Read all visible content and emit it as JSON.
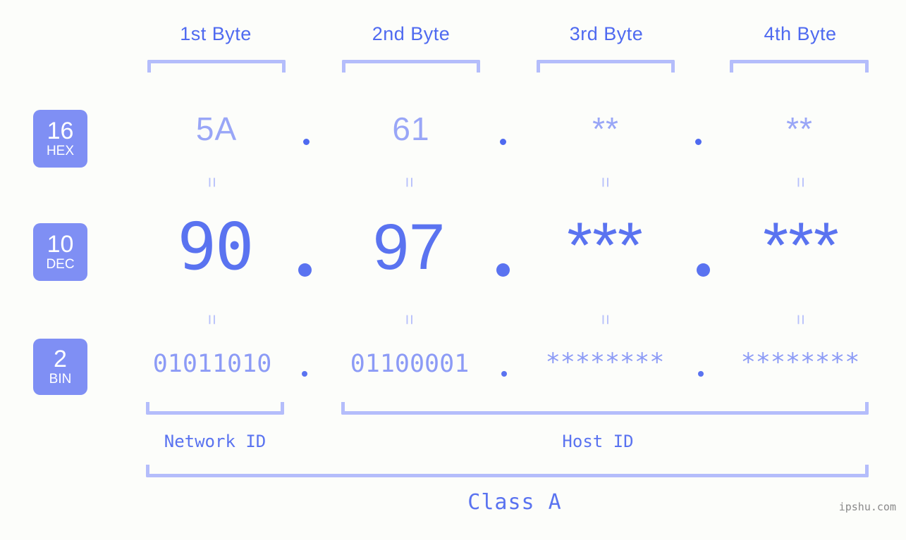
{
  "page": {
    "background_color": "#fcfdfa",
    "accent_color": "#5a73f0",
    "accent_light_color": "#b4bdfb",
    "badge_color": "#7f8ff4"
  },
  "headers": {
    "byte1": "1st Byte",
    "byte2": "2nd Byte",
    "byte3": "3rd Byte",
    "byte4": "4th Byte"
  },
  "bases": [
    {
      "number": "16",
      "name": "HEX"
    },
    {
      "number": "10",
      "name": "DEC"
    },
    {
      "number": "2",
      "name": "BIN"
    }
  ],
  "rows": {
    "hex": {
      "base_number": "16",
      "base_name": "HEX",
      "values": [
        "5A",
        "61",
        "**",
        "**"
      ],
      "separator": "."
    },
    "dec": {
      "base_number": "10",
      "base_name": "DEC",
      "values": [
        "90",
        "97",
        "***",
        "***"
      ],
      "separator": "."
    },
    "bin": {
      "base_number": "2",
      "base_name": "BIN",
      "values": [
        "01011010",
        "01100001",
        "********",
        "********"
      ],
      "separator": "."
    }
  },
  "equals": {
    "hex_to_dec": [
      "=",
      "=",
      "=",
      "="
    ],
    "dec_to_bin": [
      "=",
      "=",
      "=",
      "="
    ]
  },
  "sections": {
    "network_id": "Network ID",
    "host_id": "Host ID",
    "class": "Class A"
  },
  "watermark": "ipshu.com"
}
